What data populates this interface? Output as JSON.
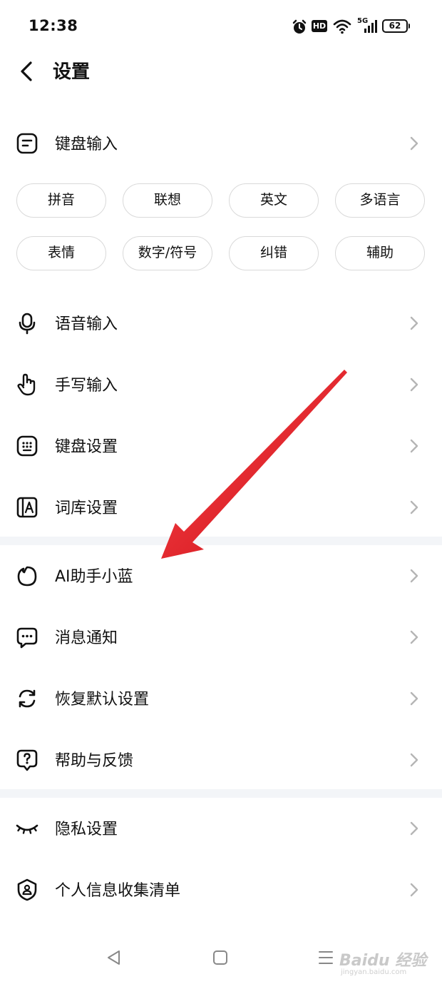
{
  "status_bar": {
    "time": "12:38",
    "hd_label": "HD",
    "network_label": "5G",
    "battery_level": "62"
  },
  "header": {
    "title": "设置"
  },
  "keyboard_input": {
    "label": "键盘输入",
    "chips_row1": [
      "拼音",
      "联想",
      "英文",
      "多语言"
    ],
    "chips_row2": [
      "表情",
      "数字/符号",
      "纠错",
      "辅助"
    ]
  },
  "menu": {
    "voice_input": "语音输入",
    "handwriting_input": "手写输入",
    "keyboard_settings": "键盘设置",
    "lexicon_settings": "词库设置",
    "ai_assistant": "AI助手小蓝",
    "notifications": "消息通知",
    "restore_defaults": "恢复默认设置",
    "help_feedback": "帮助与反馈",
    "privacy_settings": "隐私设置",
    "personal_info_list": "个人信息收集清单"
  },
  "watermark": {
    "brand": "Baidu 经验",
    "url": "jingyan.baidu.com"
  },
  "colors": {
    "accent_arrow": "#e8141b",
    "divider": "#f3f5f8",
    "chip_border": "#d9d9d9",
    "chevron": "#b5b5b5"
  }
}
